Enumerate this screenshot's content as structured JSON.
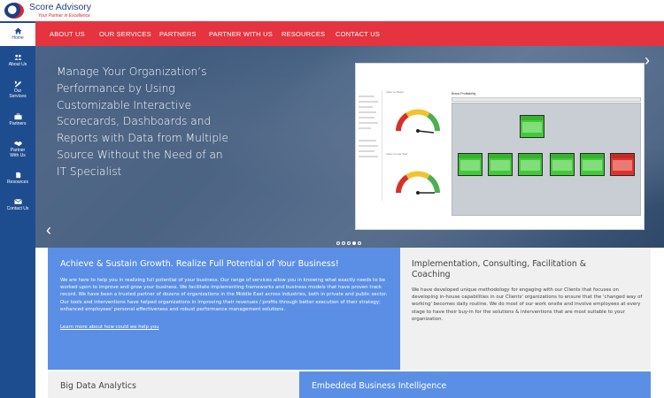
{
  "brand": {
    "title": "Score Advisory",
    "tagline": "Your Partner in Excellence",
    "colors": {
      "navy": "#1e4d8f",
      "red": "#e5343f",
      "blue_block": "#5b8fe6"
    }
  },
  "sidebar": {
    "items": [
      {
        "label": "Home",
        "icon": "home-icon",
        "active": true
      },
      {
        "label": "About Us",
        "icon": "people-icon"
      },
      {
        "label": "Our Services",
        "icon": "tools-icon"
      },
      {
        "label": "Partners",
        "icon": "briefcase-icon"
      },
      {
        "label": "Partner With Us",
        "icon": "handshake-icon"
      },
      {
        "label": "Resources",
        "icon": "document-icon"
      },
      {
        "label": "Contact Us",
        "icon": "envelope-icon"
      }
    ]
  },
  "nav": {
    "links": [
      "ABOUT US",
      "OUR SERVICES",
      "PARTNERS",
      "PARTNER WITH US",
      "RESOURCES",
      "CONTACT US"
    ]
  },
  "hero": {
    "headline": "Manage Your Organization’s Performance by Using Customizable Interactive Scorecards, Dashboards and Reports with Data from Multiple Source Without the Need of an IT Specialist",
    "slides_total": 5,
    "active_slide": 4,
    "dashboard": {
      "gauge_label_1": "Index to Target",
      "gauge_label_2": "Index to Last Year",
      "board_title": "Brand Profitability"
    }
  },
  "blocks": {
    "growth": {
      "title": "Achieve & Sustain Growth. Realize Full Potential of Your Business!",
      "body": "We are here to help you in realizing full potential of your business. Our range of services allow you in knowing what exactly needs to be worked upon to improve and grow your business. We facilitate implementing frameworks and business models that have proven track record. We have been a trusted partner of dozens of organizations in the Middle East across industries, both in private and public sector. Our tools and interventions have helped organizations in improving their revenues / profits through better execution of their strategy; enhanced employees' personal effectiveness and robust performance management solutions.",
      "link": "Learn more about how could we help you"
    },
    "implementation": {
      "title": "Implementation, Consulting, Facilitation & Coaching",
      "body": "We have developed unique methodology for engaging with our Clients that focuses on developing in-house capabilities in our Clients' organizations to ensure that the 'changed way of working' becomes daily routine. We do most of our work onsite and involve employees at every stage to have their buy-in for the solutions & interventions that are most suitable to your organization."
    },
    "bigdata": {
      "title": "Big Data Analytics"
    },
    "embedded": {
      "title": "Embedded Business Intelligence"
    }
  }
}
